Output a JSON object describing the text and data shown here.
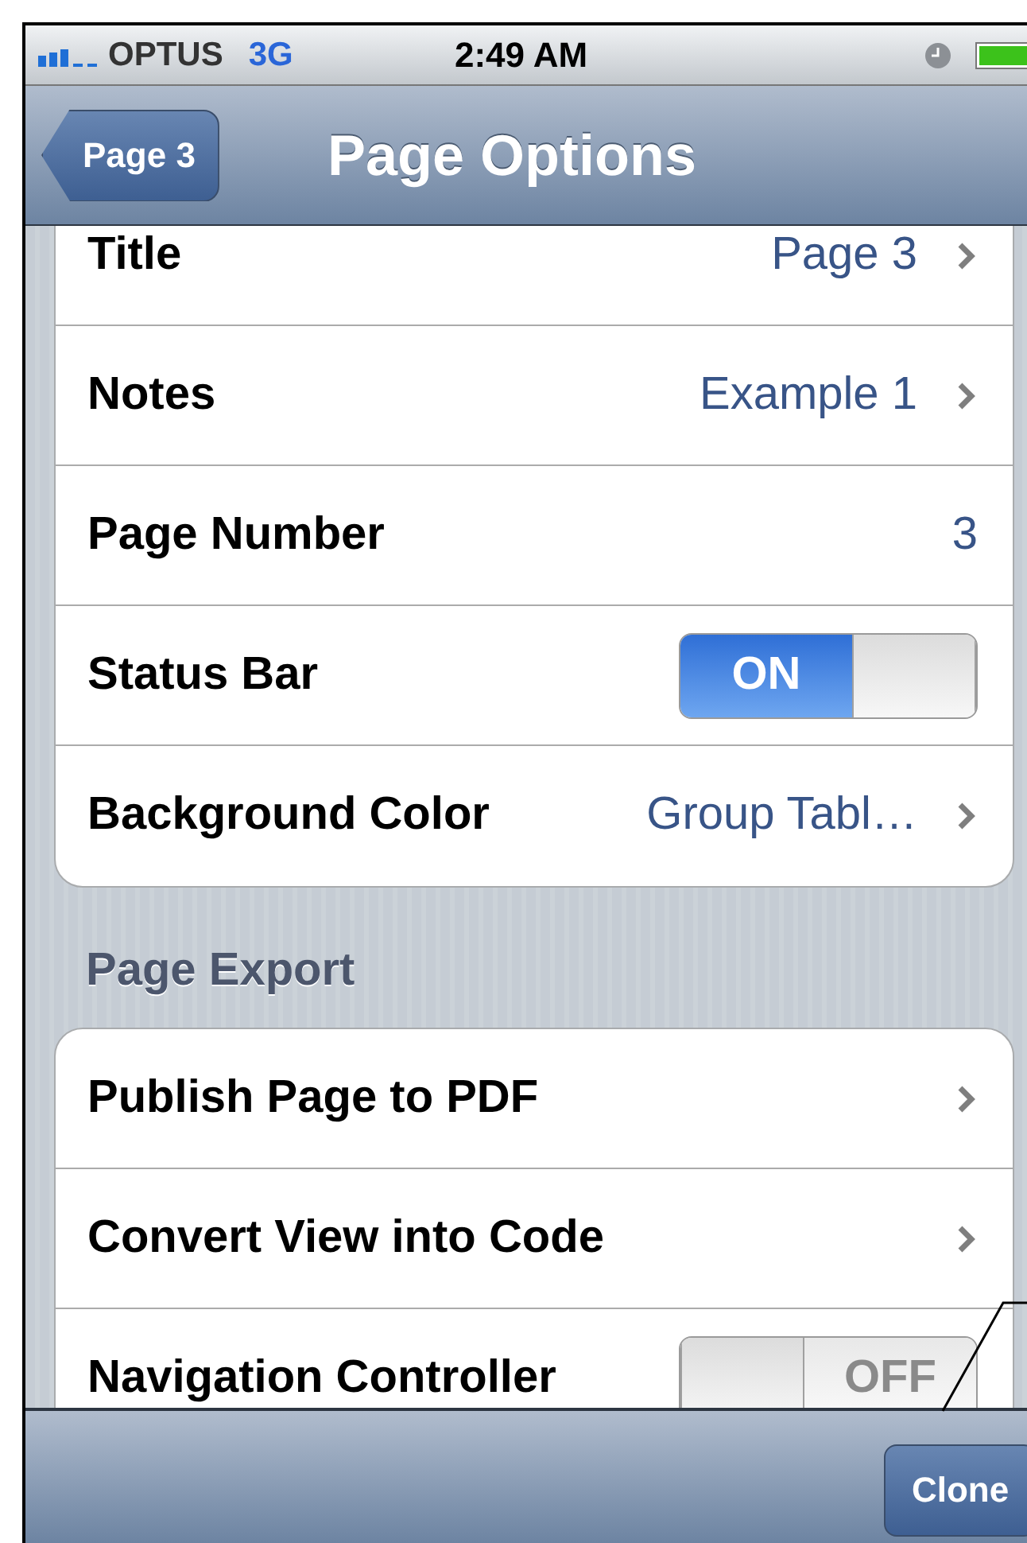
{
  "status_bar": {
    "carrier": "OPTUS",
    "network": "3G",
    "time": "2:49 AM"
  },
  "nav_bar": {
    "back": "Page 3",
    "title": "Page Options"
  },
  "groups": [
    {
      "rows": [
        {
          "kind": "detail",
          "label": "Title",
          "value": "Page 3"
        },
        {
          "kind": "detail",
          "label": "Notes",
          "value": "Example 1"
        },
        {
          "kind": "value",
          "label": "Page Number",
          "value": "3"
        },
        {
          "kind": "switch",
          "label": "Status Bar",
          "on": true,
          "text": "ON"
        },
        {
          "kind": "detail",
          "label": "Background Color",
          "value": "Group Tabl…"
        }
      ]
    },
    {
      "header": "Page Export",
      "rows": [
        {
          "kind": "detail",
          "label": "Publish Page to PDF"
        },
        {
          "kind": "detail",
          "label": "Convert View into Code"
        },
        {
          "kind": "switch",
          "label": "Navigation Controller",
          "on": false,
          "text": "OFF"
        }
      ]
    }
  ],
  "toolbar": {
    "button": "Clone"
  }
}
